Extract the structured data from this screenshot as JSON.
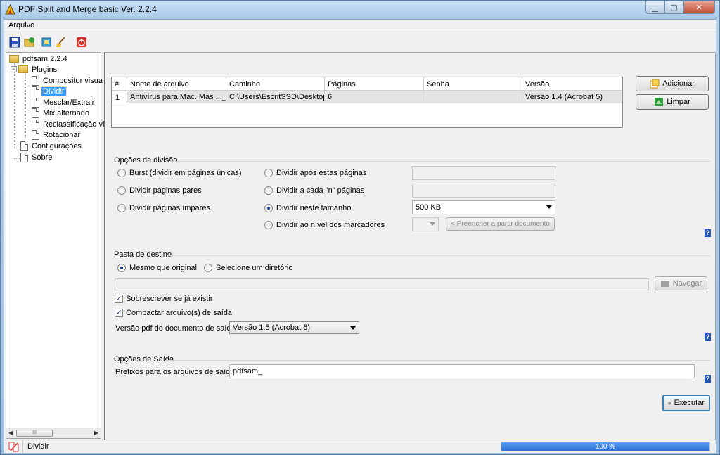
{
  "window": {
    "title": "PDF Split and Merge basic Ver. 2.2.4",
    "min_label": "▁",
    "max_label": "▢",
    "close_label": "✕"
  },
  "menu": {
    "file": "Arquivo"
  },
  "toolbar": {
    "icons": [
      "save-icon",
      "open-icon",
      "environment-icon",
      "clear-icon",
      "exit-icon"
    ]
  },
  "tree": {
    "root": "pdfsam 2.2.4",
    "plugins": "Plugins",
    "items": [
      "Compositor visua",
      "Dividir",
      "Mesclar/Extrair",
      "Mix alternado",
      "Reclassificação vis",
      "Rotacionar"
    ],
    "settings": "Configurações",
    "about": "Sobre"
  },
  "file_table": {
    "headers": [
      "#",
      "Nome de arquivo",
      "Caminho",
      "Páginas",
      "Senha",
      "Versão"
    ],
    "rows": [
      [
        "1",
        "Antivírus para Mac. Mas ..._ ...",
        "C:\\Users\\EscritSSD\\Desktop...",
        "6",
        "",
        "Versão 1.4 (Acrobat 5)"
      ]
    ]
  },
  "buttons": {
    "add": "Adicionar",
    "clear": "Limpar",
    "browse": "Navegar",
    "fill_from_doc": "< Preencher a partir documento",
    "run": "Executar"
  },
  "split_options": {
    "title": "Opções de divisão",
    "burst": "Burst (dividir em páginas únicas)",
    "even": "Dividir páginas pares",
    "odd": "Dividir páginas ímpares",
    "after_pages": "Dividir após estas páginas",
    "every_n": "Dividir a cada \"n\" páginas",
    "by_size": "Dividir neste tamanho",
    "by_bookmarks": "Dividir ao nível dos marcadores",
    "selected": "by_size",
    "size_value": "500 KB",
    "after_pages_value": "",
    "every_n_value": "",
    "bookmark_level_value": ""
  },
  "destination": {
    "title": "Pasta de destino",
    "same_as_source": "Mesmo que original",
    "choose_dir": "Selecione um diretório",
    "selected": "same_as_source",
    "path_value": "",
    "overwrite": "Sobrescrever se já existir",
    "overwrite_checked": true,
    "compress": "Compactar arquivo(s) de saída",
    "compress_checked": true,
    "pdf_version_label": "Versão pdf do documento de saída:",
    "pdf_version_value": "Versão 1.5 (Acrobat 6)"
  },
  "output": {
    "title": "Opções de Saída",
    "prefix_label": "Prefixos para os arquivos de saída:",
    "prefix_value": "pdfsam_"
  },
  "help_label": "?",
  "status": {
    "text": "Dividir",
    "progress_percent": 100,
    "progress_text": "100 %"
  },
  "colors": {
    "selection": "#3399ff",
    "progress": "#2b6fd6",
    "help": "#2456b8"
  }
}
